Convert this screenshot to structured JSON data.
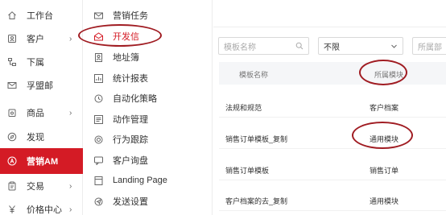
{
  "nav_primary": {
    "items": [
      {
        "label": "工作台",
        "icon": "home-icon",
        "chevron": ""
      },
      {
        "label": "客户",
        "icon": "contact-card-icon",
        "chevron": "›"
      },
      {
        "label": "下属",
        "icon": "hierarchy-icon",
        "chevron": ""
      },
      {
        "label": "孚盟邮",
        "icon": "mail-icon",
        "chevron": ""
      },
      {
        "label": "商品",
        "icon": "product-box-icon",
        "chevron": "›"
      },
      {
        "label": "发现",
        "icon": "compass-icon",
        "chevron": ""
      },
      {
        "label": "营销AM",
        "icon": "marketing-a-icon",
        "chevron": ""
      },
      {
        "label": "交易",
        "icon": "clipboard-icon",
        "chevron": "›"
      },
      {
        "label": "价格中心",
        "icon": "yen-icon",
        "chevron": "›"
      }
    ],
    "active_index": 6
  },
  "nav_secondary": {
    "items": [
      {
        "label": "营销任务",
        "icon": "envelope-icon"
      },
      {
        "label": "开发信",
        "icon": "open-envelope-icon"
      },
      {
        "label": "地址簿",
        "icon": "address-book-icon"
      },
      {
        "label": "统计报表",
        "icon": "report-icon"
      },
      {
        "label": "自动化策略",
        "icon": "automation-icon"
      },
      {
        "label": "动作管理",
        "icon": "action-list-icon"
      },
      {
        "label": "行为跟踪",
        "icon": "target-icon"
      },
      {
        "label": "客户询盘",
        "icon": "inquiry-icon"
      },
      {
        "label": "Landing Page",
        "icon": "landing-page-icon"
      },
      {
        "label": "发送设置",
        "icon": "send-settings-icon"
      }
    ],
    "active_index": 1
  },
  "filters": {
    "template_name_placeholder": "模板名称",
    "scope_value": "不限",
    "module_placeholder": "所属部"
  },
  "table": {
    "headers": {
      "name": "模板名称",
      "module": "所属模块"
    },
    "rows": [
      {
        "name": "法规和规范",
        "module": "客户档案"
      },
      {
        "name": "销售订单模板_复制",
        "module": "通用模块"
      },
      {
        "name": "销售订单模板",
        "module": "销售订单"
      },
      {
        "name": "客户档案的去_复制",
        "module": "通用模块"
      }
    ]
  },
  "colors": {
    "accent": "#d41b25",
    "annotation": "#a01c22"
  }
}
